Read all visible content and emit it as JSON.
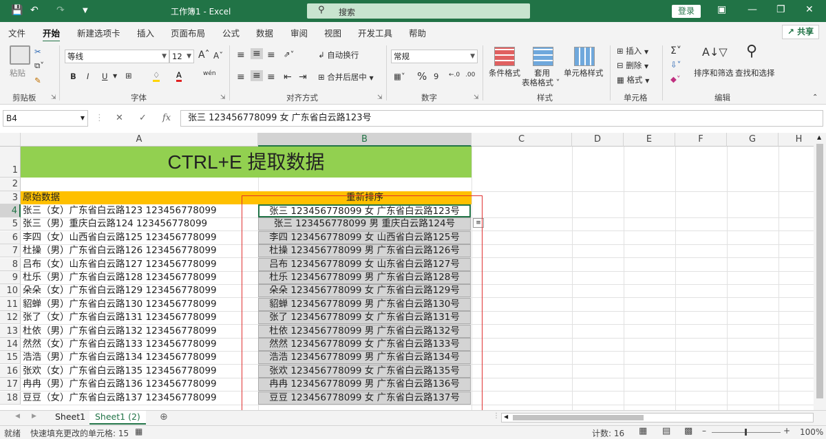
{
  "window": {
    "title": "工作簿1  -  Excel",
    "search_placeholder": "搜索",
    "login_label": "登录"
  },
  "menu": {
    "items": [
      "文件",
      "开始",
      "新建选项卡",
      "插入",
      "页面布局",
      "公式",
      "数据",
      "审阅",
      "视图",
      "开发工具",
      "帮助"
    ],
    "active": "开始",
    "share_label": "共享"
  },
  "ribbon": {
    "clipboard": {
      "paste": "粘贴",
      "group": "剪贴板"
    },
    "font": {
      "name": "等线",
      "size": "12",
      "bold": "B",
      "italic": "I",
      "underline": "U",
      "group": "字体"
    },
    "alignment": {
      "wrap": "自动换行",
      "merge": "合并后居中",
      "group": "对齐方式"
    },
    "number": {
      "format": "常规",
      "percent": "%",
      "comma": "9",
      "group": "数字"
    },
    "styles": {
      "cond": "条件格式",
      "table": "套用\n表格格式",
      "cell": "单元格样式",
      "group": "样式"
    },
    "cells": {
      "insert": "插入",
      "delete": "删除",
      "format": "格式",
      "group": "单元格"
    },
    "editing": {
      "sort": "排序和筛选",
      "find": "查找和选择",
      "group": "编辑"
    }
  },
  "formula_bar": {
    "name_box": "B4",
    "fx": "fx",
    "content": "张三 123456778099 女 广东省白云路123号"
  },
  "sheet": {
    "columns": [
      "A",
      "B",
      "C",
      "D",
      "E",
      "F",
      "G",
      "H"
    ],
    "selected_column": "B",
    "title_cell": "CTRL+E 提取数据",
    "header_a": "原始数据",
    "header_b": "重新排序",
    "rows": [
      {
        "n": "4",
        "a": "张三（女）广东省白云路123 123456778099",
        "b": "张三 123456778099 女 广东省白云路123号"
      },
      {
        "n": "5",
        "a": "张三（男）重庆白云路124 123456778099",
        "b": "张三 123456778099 男 重庆白云路124号"
      },
      {
        "n": "6",
        "a": "李四（女）山西省白云路125 123456778099",
        "b": "李四 123456778099 女 山西省白云路125号"
      },
      {
        "n": "7",
        "a": "杜操（男）广东省白云路126 123456778099",
        "b": "杜操 123456778099 男 广东省白云路126号"
      },
      {
        "n": "8",
        "a": "吕布（女）山东省白云路127 123456778099",
        "b": "吕布 123456778099 女 山东省白云路127号"
      },
      {
        "n": "9",
        "a": "杜乐（男）广东省白云路128 123456778099",
        "b": "杜乐 123456778099 男 广东省白云路128号"
      },
      {
        "n": "10",
        "a": "朵朵（女）广东省白云路129 123456778099",
        "b": "朵朵 123456778099 女 广东省白云路129号"
      },
      {
        "n": "11",
        "a": "貂蝉（男）广东省白云路130 123456778099",
        "b": "貂蝉 123456778099 男 广东省白云路130号"
      },
      {
        "n": "12",
        "a": "张了（女）广东省白云路131 123456778099",
        "b": "张了 123456778099 女 广东省白云路131号"
      },
      {
        "n": "13",
        "a": "杜依（男）广东省白云路132 123456778099",
        "b": "杜依 123456778099 男 广东省白云路132号"
      },
      {
        "n": "14",
        "a": "然然（女）广东省白云路133 123456778099",
        "b": "然然 123456778099 女 广东省白云路133号"
      },
      {
        "n": "15",
        "a": "浩浩（男）广东省白云路134 123456778099",
        "b": "浩浩 123456778099 男 广东省白云路134号"
      },
      {
        "n": "16",
        "a": "张欢（女）广东省白云路135 123456778099",
        "b": "张欢 123456778099 女 广东省白云路135号"
      },
      {
        "n": "17",
        "a": "冉冉（男）广东省白云路136 123456778099",
        "b": "冉冉 123456778099 男 广东省白云路136号"
      },
      {
        "n": "18",
        "a": "豆豆（女）广东省白云路137 123456778099",
        "b": "豆豆 123456778099 女 广东省白云路137号"
      }
    ],
    "colors": {
      "title_bg": "#92d050",
      "header_bg": "#ffc000",
      "accent": "#217346",
      "highlight_box": "#e03030"
    }
  },
  "tabs": {
    "items": [
      "Sheet1",
      "Sheet1 (2)"
    ],
    "active": "Sheet1 (2)"
  },
  "status": {
    "ready": "就绪",
    "flash_fill": "快速填充更改的单元格: 15",
    "count": "计数: 16",
    "zoom": "100%"
  }
}
